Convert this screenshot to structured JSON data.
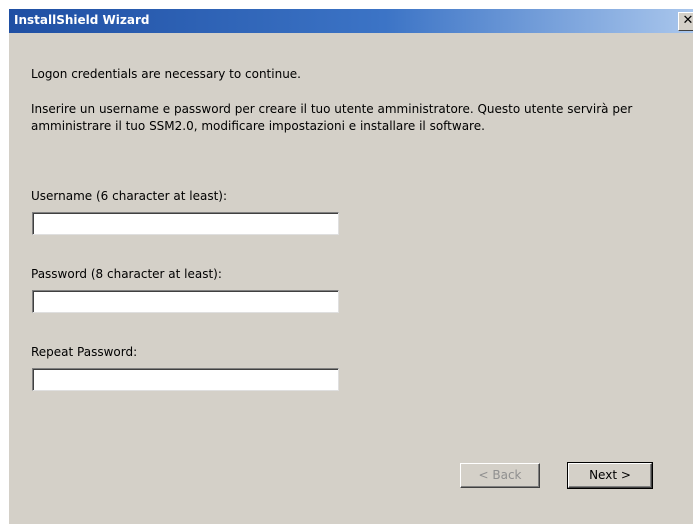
{
  "window": {
    "title": "InstallShield Wizard",
    "close_glyph": "✕"
  },
  "content": {
    "intro": "Logon credentials are necessary to continue.",
    "description": "Inserire un username e password per creare il tuo utente amministratore. Questo utente servirà per amministrare il tuo SSM2.0, modificare impostazioni e installare il software.",
    "username_label": "Username (6 character at least):",
    "username_value": "",
    "password_label": "Password (8 character at least):",
    "password_value": "",
    "repeat_password_label": "Repeat Password:",
    "repeat_password_value": ""
  },
  "buttons": {
    "back": "< Back",
    "next": "Next >"
  }
}
